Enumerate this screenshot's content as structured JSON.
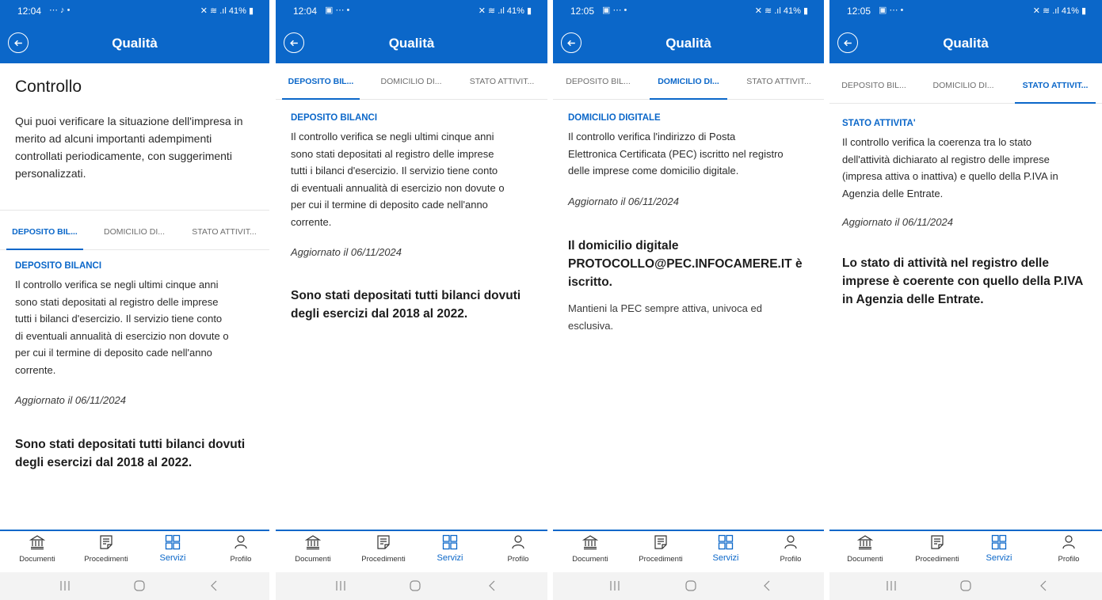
{
  "common": {
    "title": "Qualità",
    "tabs": [
      "DEPOSITO BIL...",
      "DOMICILIO DI...",
      "STATO ATTIVIT..."
    ],
    "status_right": "41%",
    "nav": [
      {
        "label": "Documenti",
        "icon": "bank-icon"
      },
      {
        "label": "Procedimenti",
        "icon": "document-icon"
      },
      {
        "label": "Servizi",
        "icon": "grid-icon"
      },
      {
        "label": "Profilo",
        "icon": "person-icon"
      }
    ],
    "active_nav": "Servizi",
    "accent_color": "#0b67c9"
  },
  "screens": [
    {
      "time": "12:04",
      "intro": {
        "title": "Controllo",
        "text": "Qui puoi verificare la situazione dell'impresa in merito ad alcuni importanti adempimenti controllati periodicamente, con suggerimenti personalizzati."
      },
      "active_tab": 0,
      "section": {
        "title": "DEPOSITO BILANCI",
        "lines": [
          "Il controllo verifica se negli ultimi cinque anni",
          "sono stati depositati al registro delle imprese",
          "tutti i bilanci d'esercizio. Il servizio tiene conto",
          "di eventuali annualità di esercizio non dovute o",
          "per cui il termine di deposito cade nell'anno",
          "corrente."
        ],
        "updated": "Aggiornato il 06/11/2024",
        "result_lines": [
          "Sono stati depositati tutti bilanci dovuti",
          "degli esercizi dal 2018 al 2022."
        ]
      }
    },
    {
      "time": "12:04",
      "active_tab": 0,
      "section": {
        "title": "DEPOSITO BILANCI",
        "lines": [
          "Il controllo verifica se negli ultimi cinque anni",
          "sono stati depositati al registro delle imprese",
          "tutti i bilanci d'esercizio. Il servizio tiene conto",
          "di eventuali annualità di esercizio non dovute o",
          "per cui il termine di deposito cade nell'anno",
          "corrente."
        ],
        "updated": "Aggiornato il 06/11/2024",
        "result_lines": [
          "Sono stati depositati tutti bilanci dovuti",
          "degli esercizi dal 2018 al 2022."
        ]
      }
    },
    {
      "time": "12:05",
      "active_tab": 1,
      "section": {
        "title": "DOMICILIO DIGITALE",
        "lines": [
          "Il controllo verifica l'indirizzo di Posta",
          "Elettronica Certificata (PEC) iscritto nel registro",
          "delle imprese come domicilio digitale."
        ],
        "updated": "Aggiornato il 06/11/2024",
        "result_lines": [
          "Il domicilio digitale",
          "PROTOCOLLO@PEC.INFOCAMERE.IT è",
          "iscritto."
        ],
        "note_lines": [
          "Mantieni la PEC sempre attiva, univoca ed",
          "esclusiva."
        ]
      }
    },
    {
      "time": "12:05",
      "active_tab": 2,
      "section": {
        "title": "STATO ATTIVITA'",
        "lines": [
          "Il controllo verifica la coerenza tra lo stato",
          "dell'attività dichiarato al registro delle imprese",
          "(impresa attiva o inattiva) e quello della P.IVA in",
          "Agenzia delle Entrate."
        ],
        "updated": "Aggiornato il 06/11/2024",
        "result_lines": [
          "Lo stato di attività nel registro delle",
          "imprese è coerente con quello della P.IVA",
          "in Agenzia delle Entrate."
        ]
      }
    }
  ]
}
